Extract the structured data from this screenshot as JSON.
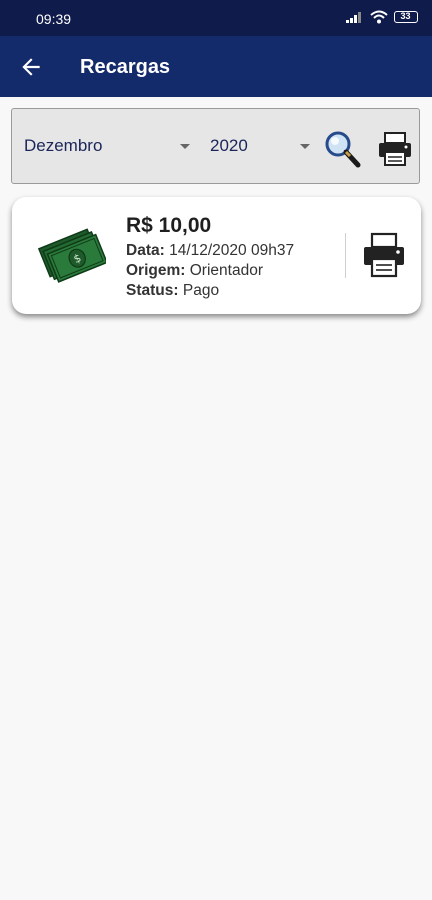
{
  "status_bar": {
    "time": "09:39",
    "battery": "33"
  },
  "app_bar": {
    "title": "Recargas"
  },
  "filter": {
    "month": "Dezembro",
    "year": "2020"
  },
  "recharges": [
    {
      "amount": "R$ 10,00",
      "date_label": "Data:",
      "date_value": "14/12/2020 09h37",
      "origin_label": "Origem:",
      "origin_value": "Orientador",
      "status_label": "Status:",
      "status_value": "Pago"
    }
  ],
  "colors": {
    "status_bar": "#0f1b4a",
    "app_bar": "#132a6b",
    "money_green": "#1e5a2a",
    "select_text": "#1b2559"
  },
  "icons": {
    "back": "arrow-left-icon",
    "search": "magnifier-icon",
    "print": "printer-icon",
    "money": "banknotes-icon"
  }
}
